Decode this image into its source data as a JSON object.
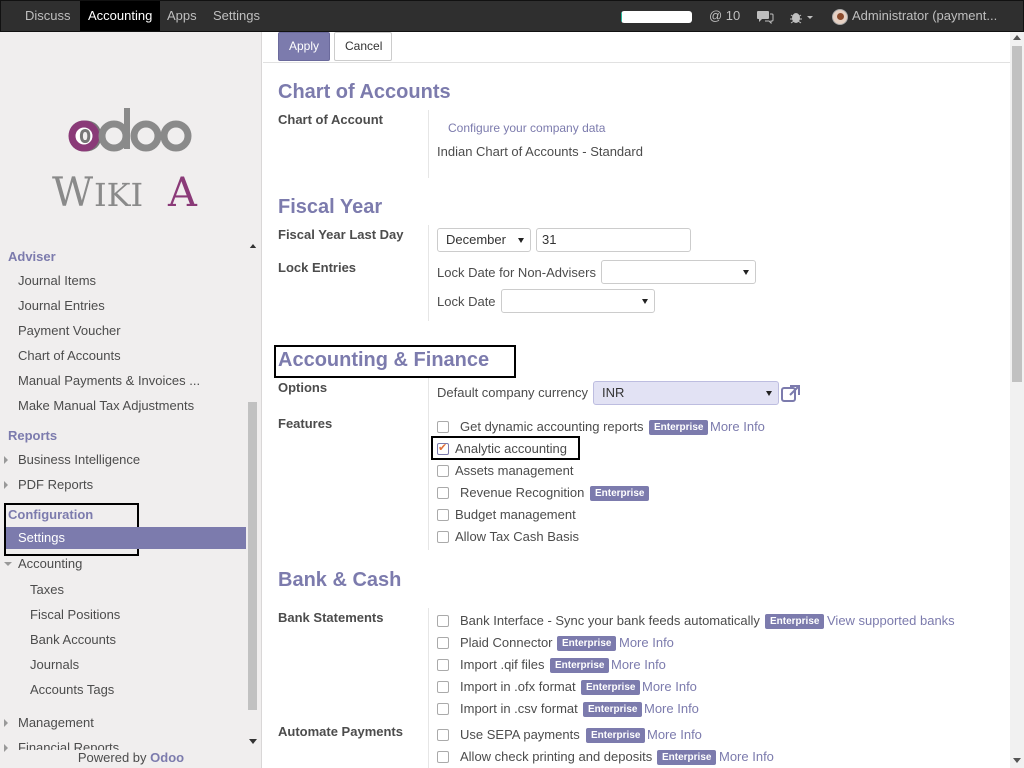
{
  "topbar": {
    "menus": [
      "Discuss",
      "Accounting",
      "Apps",
      "Settings"
    ],
    "active_menu": "Accounting",
    "progress": 0.02,
    "mentions": "@ 10",
    "user": "Administrator (payment..."
  },
  "sidebar": {
    "logo": "odoo WikiA",
    "adviser_title": "Adviser",
    "adviser_items": [
      "Journal Items",
      "Journal Entries",
      "Payment Voucher",
      "Chart of Accounts",
      "Manual Payments & Invoices ...",
      "Make Manual Tax Adjustments"
    ],
    "reports_title": "Reports",
    "reports_items": [
      "Business Intelligence",
      "PDF Reports"
    ],
    "config_title": "Configuration",
    "config_active": "Settings",
    "accounting_group": "Accounting",
    "accounting_items": [
      "Taxes",
      "Fiscal Positions",
      "Bank Accounts",
      "Journals",
      "Accounts Tags"
    ],
    "more_items": [
      "Management",
      "Financial Reports"
    ],
    "powered_by": "Powered by",
    "powered_brand": "Odoo"
  },
  "toolbar": {
    "apply": "Apply",
    "cancel": "Cancel"
  },
  "coa": {
    "title": "Chart of Accounts",
    "label": "Chart of Account",
    "configure_link": "Configure your company data",
    "value": "Indian Chart of Accounts - Standard"
  },
  "fiscal": {
    "title": "Fiscal Year",
    "last_day_label": "Fiscal Year Last Day",
    "month": "December",
    "day": "31",
    "lock_label": "Lock Entries",
    "lock_non_advisers": "Lock Date for Non-Advisers",
    "lock_date": "Lock Date"
  },
  "accfin": {
    "title": "Accounting & Finance",
    "options_label": "Options",
    "currency_label": "Default company currency",
    "currency": "INR",
    "features_label": "Features",
    "features": [
      {
        "label": "Get dynamic accounting reports",
        "checked": false,
        "badge": "Enterprise",
        "link": "More Info"
      },
      {
        "label": "Analytic accounting",
        "checked": true
      },
      {
        "label": "Assets management",
        "checked": false
      },
      {
        "label": "Revenue Recognition",
        "checked": false,
        "badge": "Enterprise"
      },
      {
        "label": "Budget management",
        "checked": false
      },
      {
        "label": "Allow Tax Cash Basis",
        "checked": false
      }
    ]
  },
  "bank": {
    "title": "Bank & Cash",
    "statements_label": "Bank Statements",
    "statements": [
      {
        "label": "Bank Interface - Sync your bank feeds automatically",
        "badge": "Enterprise",
        "link": "View supported banks"
      },
      {
        "label": "Plaid Connector",
        "badge": "Enterprise",
        "link": "More Info"
      },
      {
        "label": "Import .qif files",
        "badge": "Enterprise",
        "link": "More Info"
      },
      {
        "label": "Import in .ofx format",
        "badge": "Enterprise",
        "link": "More Info"
      },
      {
        "label": "Import in .csv format",
        "badge": "Enterprise",
        "link": "More Info"
      }
    ],
    "automate_label": "Automate Payments",
    "automate": [
      {
        "label": "Use SEPA payments",
        "badge": "Enterprise",
        "link": "More Info"
      },
      {
        "label": "Allow check printing and deposits",
        "badge": "Enterprise",
        "link": "More Info"
      }
    ]
  }
}
